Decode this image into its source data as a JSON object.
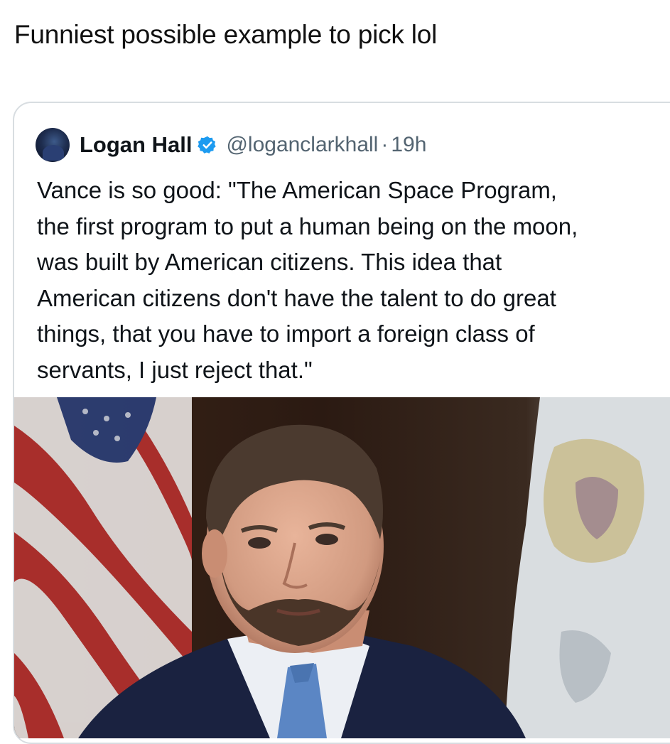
{
  "post": {
    "text": "Funniest possible example to pick lol"
  },
  "quoted_tweet": {
    "author_name": "Logan Hall",
    "handle": "@loganclarkhall",
    "separator": "·",
    "time": "19h",
    "verified_color": "#1d9bf0",
    "body_lines": [
      "Vance is so good: \"The American Space Program,",
      "the first program to put a human being on the moon,",
      "was built by American citizens. This idea that",
      "American citizens don't have the talent to do great",
      "things, that you have to import a foreign class of",
      "servants, I just reject that.\""
    ]
  }
}
